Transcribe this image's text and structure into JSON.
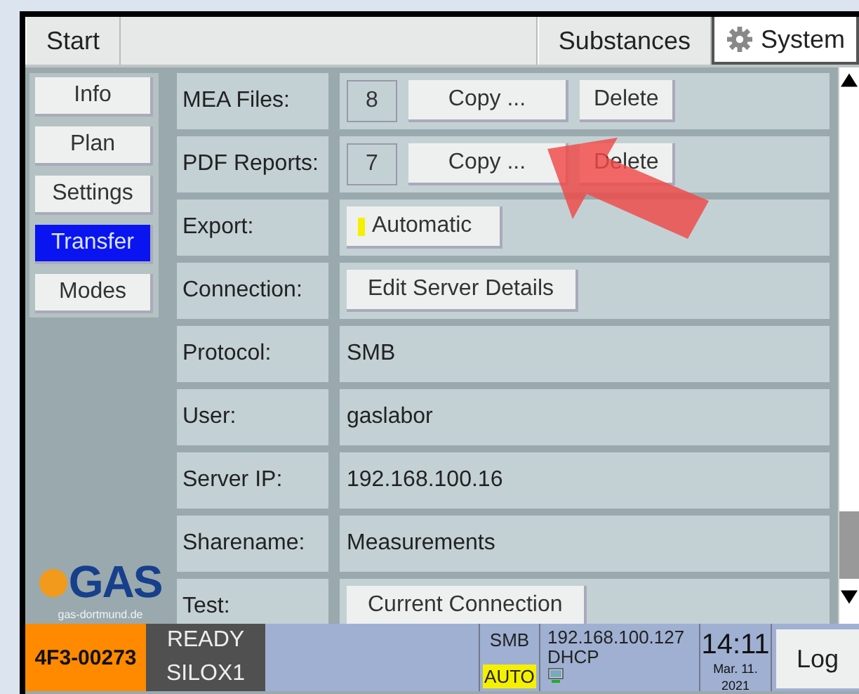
{
  "tabs": [
    {
      "label": "Start",
      "selected": false,
      "kind": "left"
    },
    {
      "label": "Substances",
      "selected": false,
      "kind": "right"
    },
    {
      "label": "System",
      "selected": true,
      "kind": "right"
    }
  ],
  "sidebar": {
    "items": [
      {
        "label": "Info",
        "selected": false
      },
      {
        "label": "Plan",
        "selected": false
      },
      {
        "label": "Settings",
        "selected": false
      },
      {
        "label": "Transfer",
        "selected": true
      },
      {
        "label": "Modes",
        "selected": false
      }
    ]
  },
  "logo": {
    "name": "GAS",
    "url": "gas-dortmund.de"
  },
  "rows": [
    {
      "label": "MEA Files:",
      "kind": "files",
      "count": "8",
      "copy": "Copy ...",
      "delete": "Delete"
    },
    {
      "label": "PDF Reports:",
      "kind": "files",
      "count": "7",
      "copy": "Copy ...",
      "delete": "Delete"
    },
    {
      "label": "Export:",
      "kind": "toggle",
      "value": "Automatic",
      "on": true
    },
    {
      "label": "Connection:",
      "kind": "button",
      "value": "Edit Server Details"
    },
    {
      "label": "Protocol:",
      "kind": "text",
      "value": "SMB"
    },
    {
      "label": "User:",
      "kind": "text",
      "value": "gaslabor"
    },
    {
      "label": "Server IP:",
      "kind": "text",
      "value": "192.168.100.16"
    },
    {
      "label": "Sharename:",
      "kind": "text",
      "value": "Measurements"
    },
    {
      "label": "Test:",
      "kind": "button",
      "value": "Current Connection"
    }
  ],
  "status_bar": {
    "device": "4F3-00273",
    "state": "READY",
    "method": "SILOX1",
    "protocol": "SMB",
    "mode": "AUTO",
    "ip": "192.168.100.127",
    "ip_mode": "DHCP",
    "time": "14:11",
    "date": "Mar. 11.",
    "year": "2021",
    "log_button": "Log"
  }
}
